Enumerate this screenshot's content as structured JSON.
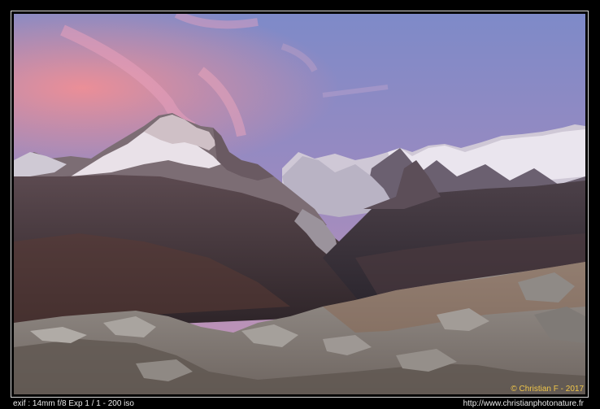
{
  "photo": {
    "credit": "© Christian F - 2017",
    "subject": "Mont Blanc massif at dusk with pink sky above snow-capped peaks and rocky foreground"
  },
  "footer": {
    "exif": "exif : 14mm f/8 Exp 1 / 1 - 200 iso",
    "url": "http://www.christianphotonature.fr"
  },
  "colors": {
    "sky_top": "#7d86c4",
    "sky_pink": "#e58aa0",
    "snow": "#e7e3ea",
    "valley": "#3a2f35",
    "foreground": "#8a8580",
    "credit_text": "#f0c64a"
  }
}
